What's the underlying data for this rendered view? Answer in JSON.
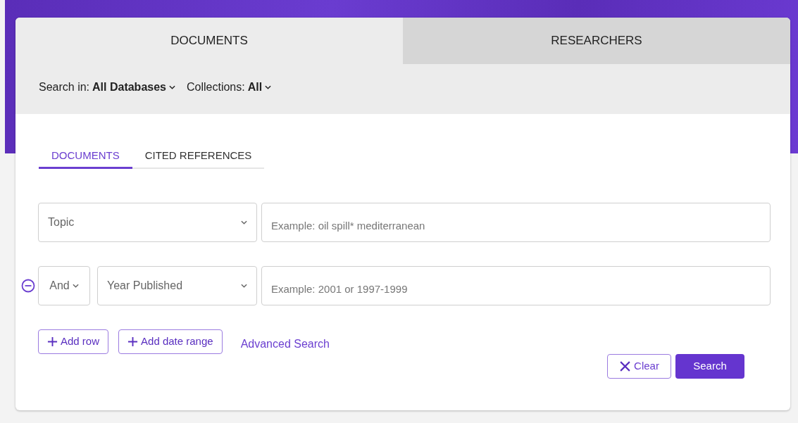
{
  "main_tabs": [
    {
      "label": "DOCUMENTS",
      "selected": true
    },
    {
      "label": "RESEARCHERS",
      "selected": false
    }
  ],
  "filters": [
    {
      "label": "Search in:",
      "value": "All Databases"
    },
    {
      "label": "Collections:",
      "value": "All"
    }
  ],
  "sub_tabs": [
    {
      "label": "DOCUMENTS",
      "selected": true
    },
    {
      "label": "CITED REFERENCES",
      "selected": false
    }
  ],
  "rows": [
    {
      "field": "Topic",
      "placeholder": "Example: oil spill* mediterranean"
    },
    {
      "operator": "And",
      "field": "Year Published",
      "placeholder": "Example: 2001 or 1997-1999"
    }
  ],
  "add_buttons": [
    "Add row",
    "Add date range"
  ],
  "advanced_link": "Advanced Search",
  "clear_button": "Clear",
  "search_button": "Search"
}
